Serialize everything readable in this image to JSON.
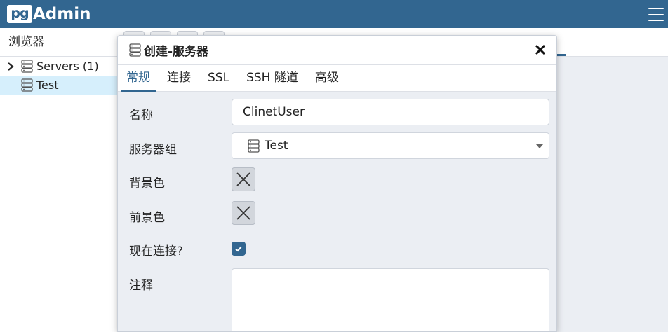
{
  "app": {
    "logo_pg": "pg",
    "logo_name": "Admin"
  },
  "browser": {
    "title": "浏览器",
    "tree": [
      {
        "label": "Servers (1)",
        "expanded": false
      },
      {
        "label": "Test",
        "selected": true
      }
    ]
  },
  "dialog": {
    "title": "创建-服务器",
    "tabs": [
      "常规",
      "连接",
      "SSL",
      "SSH 隧道",
      "高级"
    ],
    "active_tab": "常规",
    "fields": {
      "name_label": "名称",
      "name_value": "ClinetUser",
      "group_label": "服务器组",
      "group_value": "Test",
      "bgcolor_label": "背景色",
      "fgcolor_label": "前景色",
      "connect_now_label": "现在连接?",
      "connect_now_checked": true,
      "comments_label": "注释",
      "comments_value": ""
    }
  },
  "colors": {
    "brand": "#326690",
    "selected_row": "#d6effc",
    "background": "#ebeef3"
  },
  "icons": [
    "menu-icon",
    "chevron-right-icon",
    "server-group-icon",
    "close-icon",
    "clear-color-icon",
    "check-icon",
    "dropdown-arrow-icon"
  ]
}
